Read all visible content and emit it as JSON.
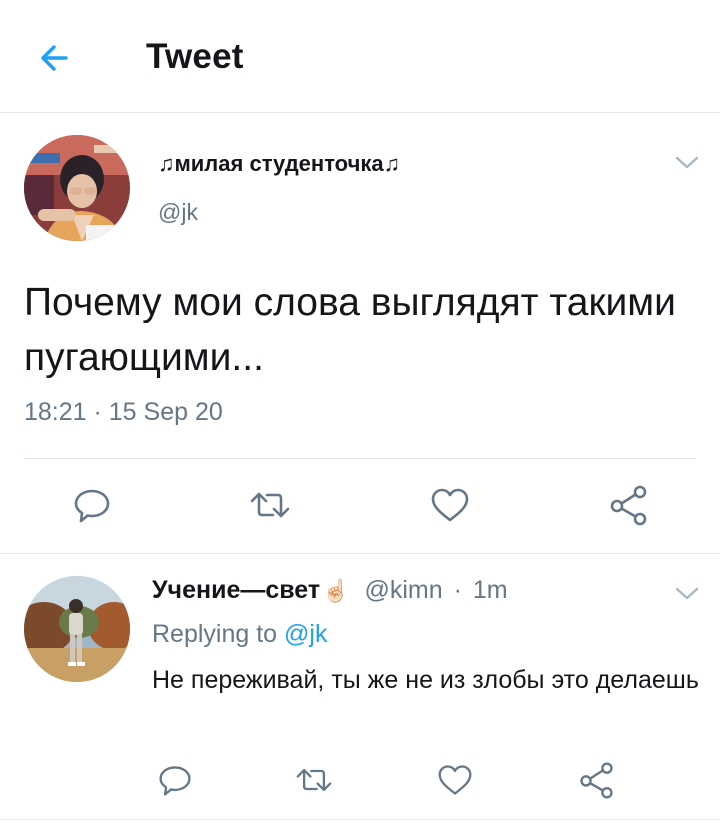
{
  "header": {
    "title": "Tweet",
    "back_icon": "arrow-left-icon",
    "accent": "#1da1f2"
  },
  "tweet": {
    "author_name": "♫милая студенточка♫",
    "author_handle": "@jk",
    "text": "Почему мои слова выглядят такими пугающими...",
    "timestamp": "18:21 · 15 Sep 20",
    "menu_icon": "chevron-down-icon",
    "actions": [
      "reply-icon",
      "retweet-icon",
      "like-icon",
      "share-icon"
    ]
  },
  "reply": {
    "author_name": "Учение—свет",
    "author_emoji": "☝🏻",
    "author_handle": "@kimn",
    "time": "1m",
    "separator": "·",
    "replying_prefix": "Replying to",
    "replying_to": "@jk",
    "text": "Не переживай, ты же не из злобы это делаешь",
    "menu_icon": "chevron-down-icon",
    "actions": [
      "reply-icon",
      "retweet-icon",
      "like-icon",
      "share-icon"
    ]
  },
  "colors": {
    "text": "#14171a",
    "secondary": "#657786",
    "divider": "#e1e8ed",
    "accent": "#1da1f2"
  }
}
